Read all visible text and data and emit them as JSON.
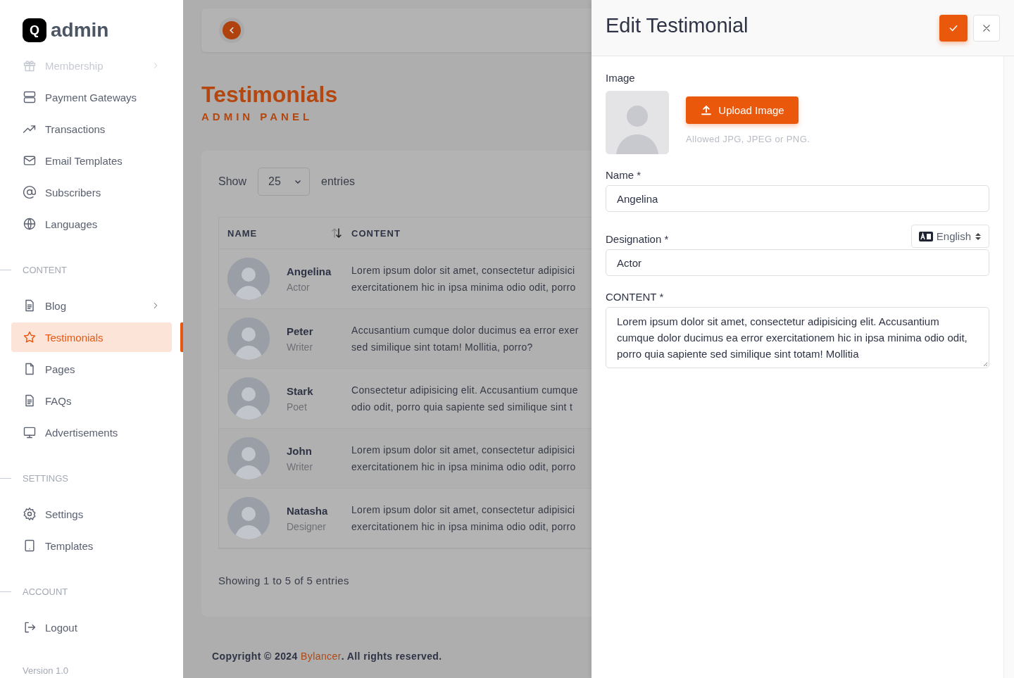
{
  "sidebar": {
    "logo": {
      "mark": "Q",
      "text": "admin"
    },
    "sections": [
      {
        "items": [
          {
            "label": "Membership",
            "selected": false,
            "disabled": true,
            "has_submenu": true
          },
          {
            "label": "Payment Gateways",
            "selected": false,
            "disabled": false,
            "has_submenu": false
          },
          {
            "label": "Transactions",
            "selected": false,
            "disabled": false,
            "has_submenu": false
          },
          {
            "label": "Email Templates",
            "selected": false,
            "disabled": false,
            "has_submenu": false
          },
          {
            "label": "Subscribers",
            "selected": false,
            "disabled": false,
            "has_submenu": false
          },
          {
            "label": "Languages",
            "selected": false,
            "disabled": false,
            "has_submenu": false
          }
        ]
      },
      {
        "heading": "CONTENT",
        "items": [
          {
            "label": "Blog",
            "selected": false,
            "disabled": false,
            "has_submenu": true
          },
          {
            "label": "Testimonials",
            "selected": true,
            "disabled": false,
            "has_submenu": false
          },
          {
            "label": "Pages",
            "selected": false,
            "disabled": false,
            "has_submenu": false
          },
          {
            "label": "FAQs",
            "selected": false,
            "disabled": false,
            "has_submenu": false
          },
          {
            "label": "Advertisements",
            "selected": false,
            "disabled": false,
            "has_submenu": false
          }
        ]
      },
      {
        "heading": "SETTINGS",
        "items": [
          {
            "label": "Settings",
            "selected": false,
            "disabled": false,
            "has_submenu": false
          },
          {
            "label": "Templates",
            "selected": false,
            "disabled": false,
            "has_submenu": false
          }
        ]
      },
      {
        "heading": "ACCOUNT",
        "items": [
          {
            "label": "Logout",
            "selected": false,
            "disabled": false,
            "has_submenu": false
          }
        ]
      }
    ],
    "version": "Version 1.0"
  },
  "main": {
    "title": "Testimonials",
    "subtitle": "ADMIN PANEL",
    "length_menu": {
      "label_before": "Show",
      "value": "25",
      "label_after": "entries"
    },
    "table": {
      "columns": [
        "NAME",
        "CONTENT"
      ],
      "rows": [
        {
          "name": "Angelina",
          "designation": "Actor",
          "content_lines": [
            "Lorem ipsum dolor sit amet, consectetur adipisici",
            "exercitationem hic in ipsa minima odio odit, porro"
          ]
        },
        {
          "name": "Peter",
          "designation": "Writer",
          "content_lines": [
            "Accusantium cumque dolor ducimus ea error exer",
            "sed similique sint totam! Mollitia, porro?"
          ]
        },
        {
          "name": "Stark",
          "designation": "Poet",
          "content_lines": [
            "Consectetur adipisicing elit. Accusantium cumque",
            "odio odit, porro quia sapiente sed similique sint t"
          ]
        },
        {
          "name": "John",
          "designation": "Writer",
          "content_lines": [
            "Lorem ipsum dolor sit amet, consectetur adipisici",
            "exercitationem hic in ipsa minima odio odit, porro"
          ]
        },
        {
          "name": "Natasha",
          "designation": "Designer",
          "content_lines": [
            "Lorem ipsum dolor sit amet, consectetur adipisici",
            "exercitationem hic in ipsa minima odio odit, porro"
          ]
        }
      ]
    },
    "info": "Showing 1 to 5 of 5 entries",
    "footer": {
      "text_before": "Copyright © 2024 ",
      "link": "Bylancer",
      "text_after": ". All rights reserved."
    }
  },
  "drawer": {
    "title": "Edit Testimonial",
    "image_label": "Image",
    "upload_button": "Upload Image",
    "upload_hint": "Allowed JPG, JPEG or PNG.",
    "fields": [
      {
        "kind": "input",
        "label": "Name *",
        "value": "Angelina"
      },
      {
        "kind": "input",
        "label": "Designation *",
        "value": "Actor",
        "language": "English"
      },
      {
        "kind": "textarea",
        "label": "CONTENT *",
        "value": "Lorem ipsum dolor sit amet, consectetur adipisicing elit. Accusantium cumque dolor ducimus ea error exercitationem hic in ipsa minima odio odit, porro quia sapiente sed similique sint totam! Mollitia"
      }
    ]
  }
}
